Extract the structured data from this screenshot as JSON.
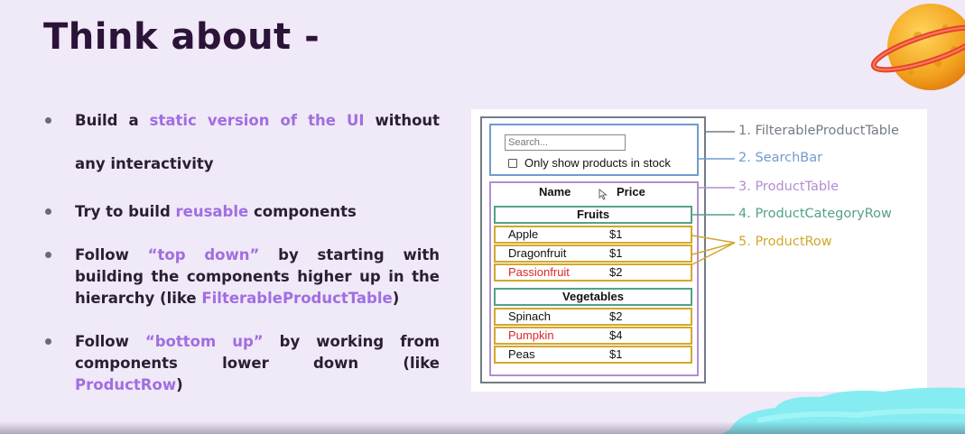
{
  "slide": {
    "title": "Think about -"
  },
  "bullets": [
    {
      "lines": [
        [
          {
            "t": "Build"
          },
          {
            "t": "a"
          },
          {
            "t": "static",
            "hl": true
          },
          {
            "t": "version",
            "hl": true
          },
          {
            "t": "of",
            "hl": true
          },
          {
            "t": "the",
            "hl": true
          },
          {
            "t": "UI",
            "hl": true
          },
          {
            "t": "without"
          }
        ],
        [
          {
            "t": "any"
          },
          {
            "t": "interactivity"
          }
        ]
      ]
    },
    {
      "lines": [
        [
          {
            "t": "Try"
          },
          {
            "t": "to"
          },
          {
            "t": "build"
          },
          {
            "t": "reusable",
            "hl": true
          },
          {
            "t": "components"
          }
        ]
      ]
    },
    {
      "lines": [
        [
          {
            "t": "Follow"
          },
          {
            "t": "“top",
            "hl": true
          },
          {
            "t": "down”",
            "hl": true
          },
          {
            "t": "by"
          },
          {
            "t": "starting"
          },
          {
            "t": "with"
          }
        ],
        [
          {
            "t": "building"
          },
          {
            "t": "the"
          },
          {
            "t": "components"
          },
          {
            "t": "higher"
          },
          {
            "t": "up"
          },
          {
            "t": "in"
          },
          {
            "t": "the"
          }
        ],
        [
          {
            "t": "hierarchy"
          },
          {
            "t": "(like"
          },
          {
            "t": "FilterableProductTable",
            "hl": true
          },
          {
            "t": ")"
          }
        ]
      ]
    },
    {
      "lines": [
        [
          {
            "t": "Follow"
          },
          {
            "t": "“bottom",
            "hl": true
          },
          {
            "t": "up”",
            "hl": true
          },
          {
            "t": "by"
          },
          {
            "t": "working"
          },
          {
            "t": "from"
          }
        ],
        [
          {
            "t": "components"
          },
          {
            "t": "lower"
          },
          {
            "t": "down"
          },
          {
            "t": "(like"
          }
        ],
        [
          {
            "t": "ProductRow",
            "hl": true
          },
          {
            "t": ")"
          }
        ]
      ]
    }
  ],
  "colors": {
    "highlight": "#a06ee1",
    "title": "#2b1438",
    "body": "#2a1f33"
  },
  "diagram": {
    "search_placeholder": "Search...",
    "checkbox_label": "Only show products in stock",
    "header_name": "Name",
    "header_price": "Price",
    "categories": [
      {
        "name": "Fruits",
        "rows": [
          {
            "name": "Apple",
            "price": "$1",
            "stocked": true
          },
          {
            "name": "Dragonfruit",
            "price": "$1",
            "stocked": true
          },
          {
            "name": "Passionfruit",
            "price": "$2",
            "stocked": false
          }
        ]
      },
      {
        "name": "Vegetables",
        "rows": [
          {
            "name": "Spinach",
            "price": "$2",
            "stocked": true
          },
          {
            "name": "Pumpkin",
            "price": "$4",
            "stocked": false
          },
          {
            "name": "Peas",
            "price": "$1",
            "stocked": true
          }
        ]
      }
    ],
    "legend": [
      {
        "label": "1. FilterableProductTable",
        "color": "#737b85"
      },
      {
        "label": "2. SearchBar",
        "color": "#6f9bd0"
      },
      {
        "label": "3. ProductTable",
        "color": "#b08ed1"
      },
      {
        "label": "4. ProductCategoryRow",
        "color": "#55a08a"
      },
      {
        "label": "5. ProductRow",
        "color": "#d3a72b"
      }
    ]
  }
}
